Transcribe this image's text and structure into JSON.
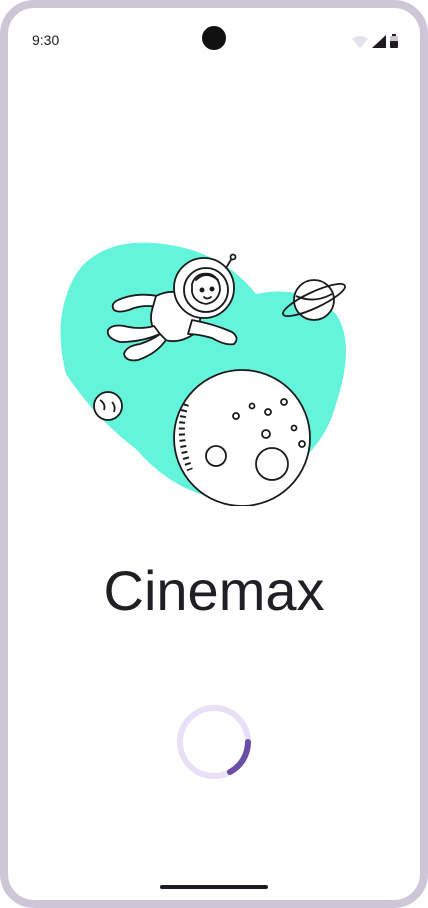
{
  "status_bar": {
    "time": "9:30",
    "icons": [
      "wifi-icon",
      "signal-icon",
      "battery-icon"
    ]
  },
  "illustration": {
    "subject": "astronaut-floating-in-space",
    "colors": {
      "blob": "#64f4dc",
      "line": "#1a1a1a",
      "fill": "#ffffff",
      "accent": "#f5c518"
    }
  },
  "app": {
    "title": "Cinemax"
  },
  "loader": {
    "colors": {
      "track": "#e8e0f7",
      "indicator": "#6a4ea6"
    }
  }
}
